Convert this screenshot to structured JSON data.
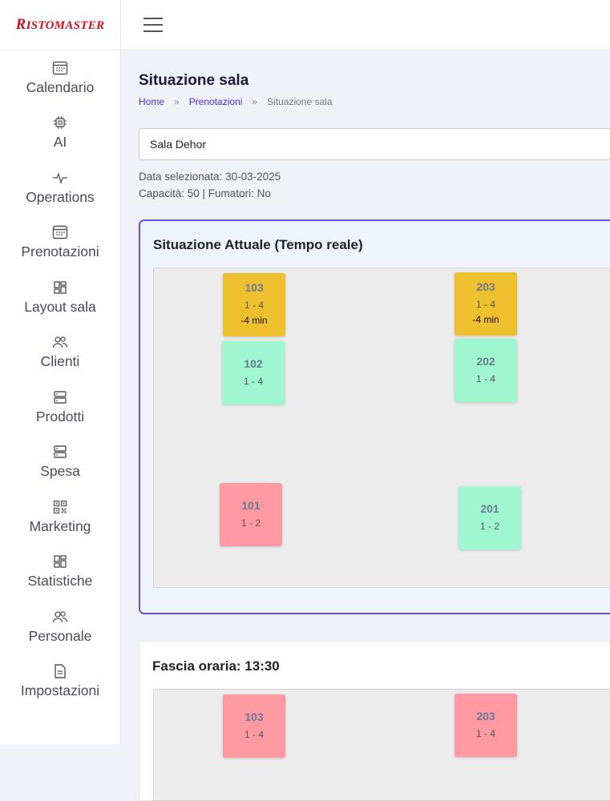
{
  "brand": {
    "logo_first": "R",
    "logo_rest": "ISTOMASTER"
  },
  "sidebar": {
    "items": [
      {
        "label": "Calendario",
        "icon": "calendar-icon"
      },
      {
        "label": "AI",
        "icon": "chip-icon"
      },
      {
        "label": "Operations",
        "icon": "activity-icon"
      },
      {
        "label": "Prenotazioni",
        "icon": "calendar-icon"
      },
      {
        "label": "Layout sala",
        "icon": "grid-icon"
      },
      {
        "label": "Clienti",
        "icon": "users-icon"
      },
      {
        "label": "Prodotti",
        "icon": "server-icon"
      },
      {
        "label": "Spesa",
        "icon": "server-icon"
      },
      {
        "label": "Marketing",
        "icon": "qrcode-icon"
      },
      {
        "label": "Statistiche",
        "icon": "grid-icon"
      },
      {
        "label": "Personale",
        "icon": "users-icon"
      },
      {
        "label": "Impostazioni",
        "icon": "document-icon"
      }
    ]
  },
  "page": {
    "title": "Situazione sala",
    "breadcrumb": [
      "Home",
      "Prenotazioni",
      "Situazione sala"
    ],
    "breadcrumb_sep": "»",
    "room_select": "Sala Dehor",
    "selected_date": "Data selezionata: 30-03-2025",
    "capacity": "Capacità: 50 | Fumatori: No"
  },
  "current": {
    "title": "Situazione Attuale (Tempo reale)",
    "tables": [
      {
        "num": "103",
        "cap": "1 - 4",
        "time": "-4 min",
        "status": "busy"
      },
      {
        "num": "102",
        "cap": "1 - 4",
        "time": "",
        "status": "free"
      },
      {
        "num": "101",
        "cap": "1 - 2",
        "time": "",
        "status": "reserved"
      },
      {
        "num": "203",
        "cap": "1 - 4",
        "time": "-4 min",
        "status": "busy"
      },
      {
        "num": "202",
        "cap": "1 - 4",
        "time": "",
        "status": "free"
      },
      {
        "num": "201",
        "cap": "1 - 2",
        "time": "",
        "status": "free"
      }
    ]
  },
  "slot": {
    "title": "Fascia oraria: 13:30",
    "tables": [
      {
        "num": "103",
        "cap": "1 - 4",
        "status": "reserved"
      },
      {
        "num": "203",
        "cap": "1 - 4",
        "status": "reserved"
      }
    ]
  },
  "colors": {
    "busy": "#efc02e",
    "free": "#9ff7cf",
    "reserved": "#ff9aa3",
    "accent": "#6a4fe0",
    "logo": "#c9111e"
  }
}
